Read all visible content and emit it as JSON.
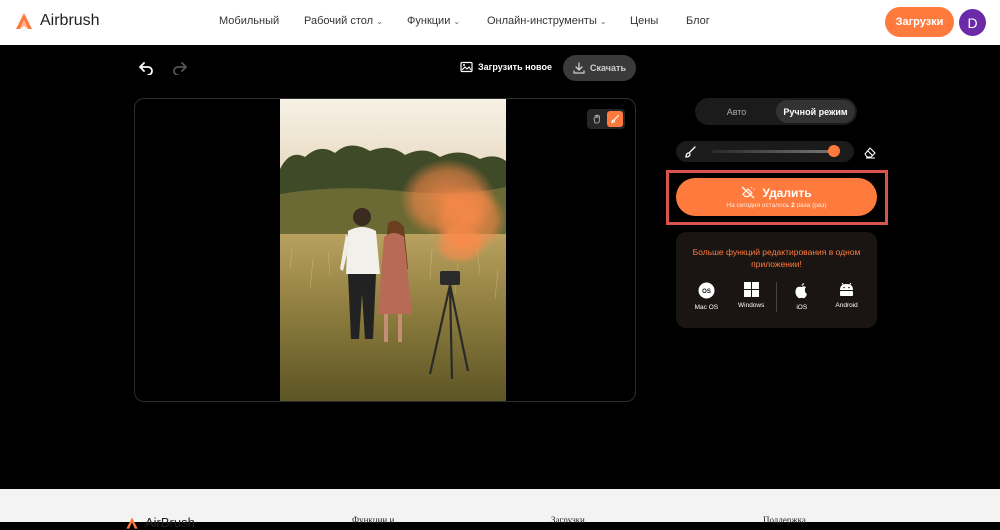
{
  "header": {
    "brand": "Airbrush",
    "nav": [
      {
        "label": "Мобильный",
        "has_dropdown": false
      },
      {
        "label": "Рабочий стол",
        "has_dropdown": true
      },
      {
        "label": "Функции",
        "has_dropdown": true
      },
      {
        "label": "Онлайн-инструменты",
        "has_dropdown": true
      },
      {
        "label": "Цены",
        "has_dropdown": false
      },
      {
        "label": "Блог",
        "has_dropdown": false
      }
    ],
    "downloads_label": "Загрузки",
    "avatar_letter": "D"
  },
  "toolbar": {
    "upload_new_label": "Загрузить новое",
    "download_label": "Скачать"
  },
  "side_panel": {
    "modes": {
      "auto": "Авто",
      "manual": "Ручной режим",
      "active": "manual"
    },
    "brush_size": 0.95,
    "delete": {
      "label": "Удалить",
      "sub_prefix": "На сегодня осталось",
      "sub_count": "2",
      "sub_suffix": "раза (раз)"
    },
    "promo": {
      "text": "Больше функций редактирования в одном приложении!",
      "platforms": [
        "Mac OS",
        "Windows",
        "iOS",
        "Android"
      ]
    }
  },
  "footer": {
    "brand": "AirBrush",
    "columns": [
      "Функции и",
      "Загрузки",
      "Поддержка"
    ]
  },
  "colors": {
    "accent": "#ff7a3d",
    "avatar": "#6b2aa8",
    "highlight": "#d9534f"
  }
}
